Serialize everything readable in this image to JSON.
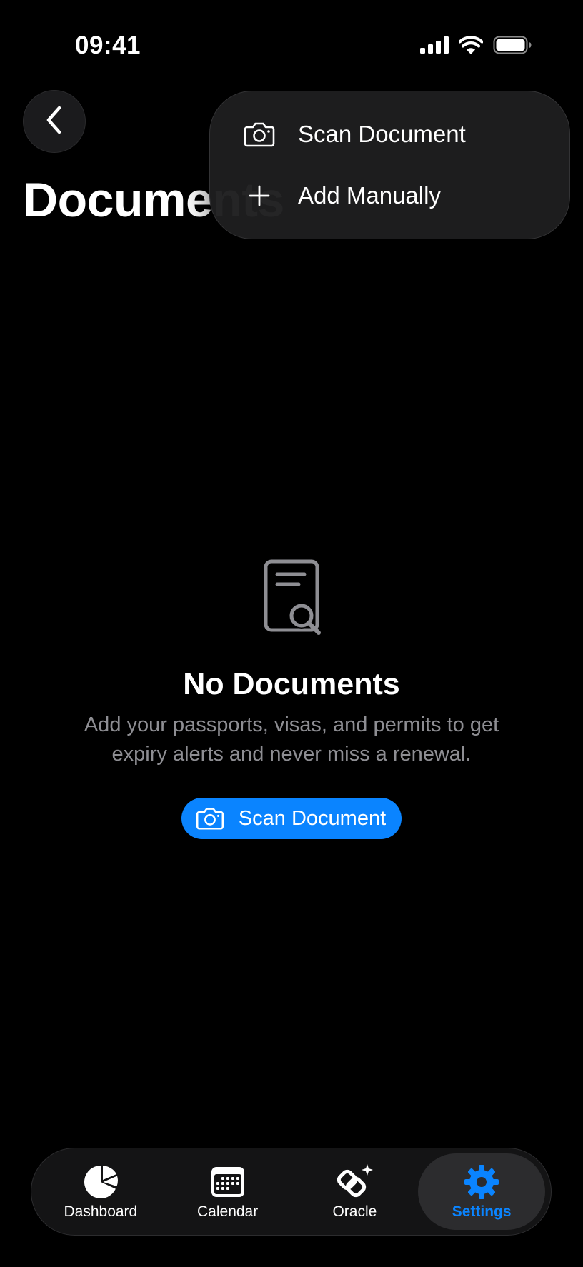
{
  "status_bar": {
    "time": "09:41"
  },
  "header": {
    "title": "Documents",
    "back_icon": "chevron-left-icon"
  },
  "menu": {
    "items": [
      {
        "label": "Scan Document",
        "icon": "camera-icon"
      },
      {
        "label": "Add Manually",
        "icon": "plus-icon"
      }
    ]
  },
  "empty_state": {
    "icon": "document-search-icon",
    "title": "No Documents",
    "description": "Add your passports, visas, and permits to get expiry alerts and never miss a renewal.",
    "button_label": "Scan Document",
    "button_icon": "camera-icon"
  },
  "tab_bar": {
    "tabs": [
      {
        "label": "Dashboard",
        "icon": "pie-chart-icon",
        "active": false
      },
      {
        "label": "Calendar",
        "icon": "calendar-icon",
        "active": false
      },
      {
        "label": "Oracle",
        "icon": "oracle-sparkle-icon",
        "active": false
      },
      {
        "label": "Settings",
        "icon": "gear-icon",
        "active": true
      }
    ]
  },
  "colors": {
    "accent": "#0a84ff",
    "background": "#000000",
    "secondary_text": "#8e8e93"
  }
}
